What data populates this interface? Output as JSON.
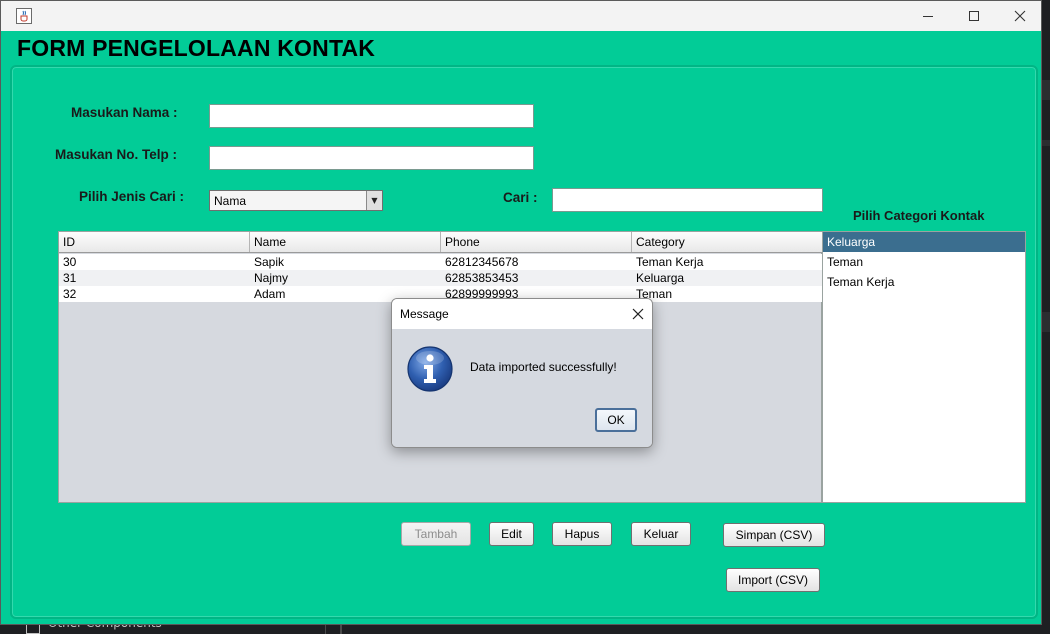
{
  "window": {
    "title": "",
    "icon": "java-cup-icon"
  },
  "form": {
    "title": "FORM PENGELOLAAN KONTAK",
    "nama_label": "Masukan Nama :",
    "nama_value": "",
    "telp_label": "Masukan No. Telp :",
    "telp_value": "",
    "jenis_cari_label": "Pilih Jenis Cari :",
    "jenis_cari_selected": "Nama",
    "cari_label": "Cari :",
    "cari_value": ""
  },
  "table": {
    "columns": [
      "ID",
      "Name",
      "Phone",
      "Category"
    ],
    "rows": [
      [
        "30",
        "Sapik",
        "62812345678",
        "Teman Kerja"
      ],
      [
        "31",
        "Najmy",
        "62853853453",
        "Keluarga"
      ],
      [
        "32",
        "Adam",
        "62899999993",
        "Teman"
      ]
    ]
  },
  "category": {
    "title": "Pilih Categori Kontak",
    "items": [
      "Keluarga",
      "Teman",
      "Teman Kerja"
    ],
    "selected": "Keluarga"
  },
  "buttons": {
    "tambah": "Tambah",
    "edit": "Edit",
    "hapus": "Hapus",
    "keluar": "Keluar",
    "simpan": "Simpan (CSV)",
    "import": "Import (CSV)"
  },
  "dialog": {
    "title": "Message",
    "message": "Data imported successfully!",
    "ok": "OK",
    "icon": "info-icon"
  },
  "background": {
    "ide_text": "Other Components"
  },
  "colors": {
    "form_bg": "#02cc97",
    "selection": "#3b6e8f",
    "info_blue": "#2f5fb0"
  }
}
